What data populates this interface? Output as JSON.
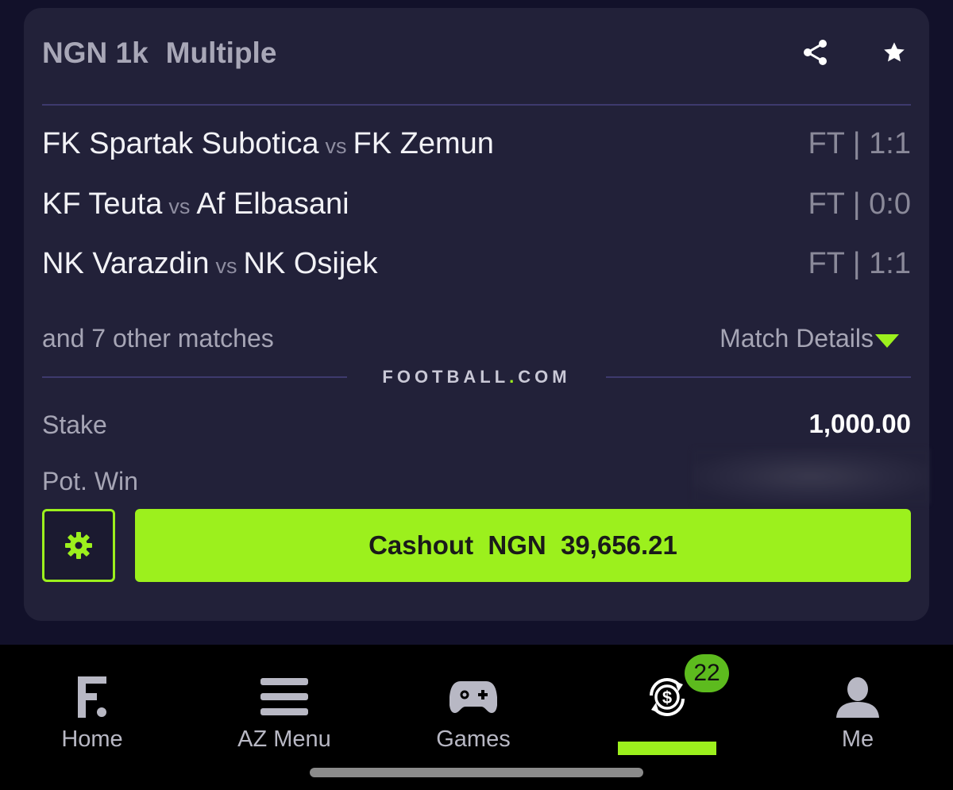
{
  "header": {
    "amount": "NGN 1k",
    "bet_type": "Multiple",
    "share_icon": "share-icon",
    "star_icon": "star-icon"
  },
  "matches": [
    {
      "home": "FK Spartak Subotica",
      "vs": "vs",
      "away": "FK Zemun",
      "result": "FT | 1:1"
    },
    {
      "home": "KF Teuta",
      "vs": "vs",
      "away": "Af Elbasani",
      "result": "FT | 0:0"
    },
    {
      "home": "NK Varazdin",
      "vs": "vs",
      "away": "NK Osijek",
      "result": "FT | 1:1"
    }
  ],
  "more_matches": "and 7 other matches",
  "match_details_label": "Match Details",
  "brand": {
    "left": "FOOTBALL",
    "dot": ".",
    "right": "COM"
  },
  "stake": {
    "label": "Stake",
    "value": "1,000.00"
  },
  "pot_win": {
    "label": "Pot. Win",
    "value": "",
    "redacted": true
  },
  "cashout": {
    "label": "Cashout  NGN  39,656.21"
  },
  "colors": {
    "accent": "#9cf01d",
    "card": "#222139",
    "background": "#12112a",
    "badge": "#5dbb1e"
  },
  "nav": {
    "items": [
      {
        "label": "Home",
        "icon": "football-logo-icon"
      },
      {
        "label": "AZ Menu",
        "icon": "menu-icon"
      },
      {
        "label": "Games",
        "icon": "gamepad-icon"
      },
      {
        "label": "",
        "icon": "cashout-icon",
        "active": true,
        "badge": "22"
      },
      {
        "label": "Me",
        "icon": "user-icon"
      }
    ]
  }
}
